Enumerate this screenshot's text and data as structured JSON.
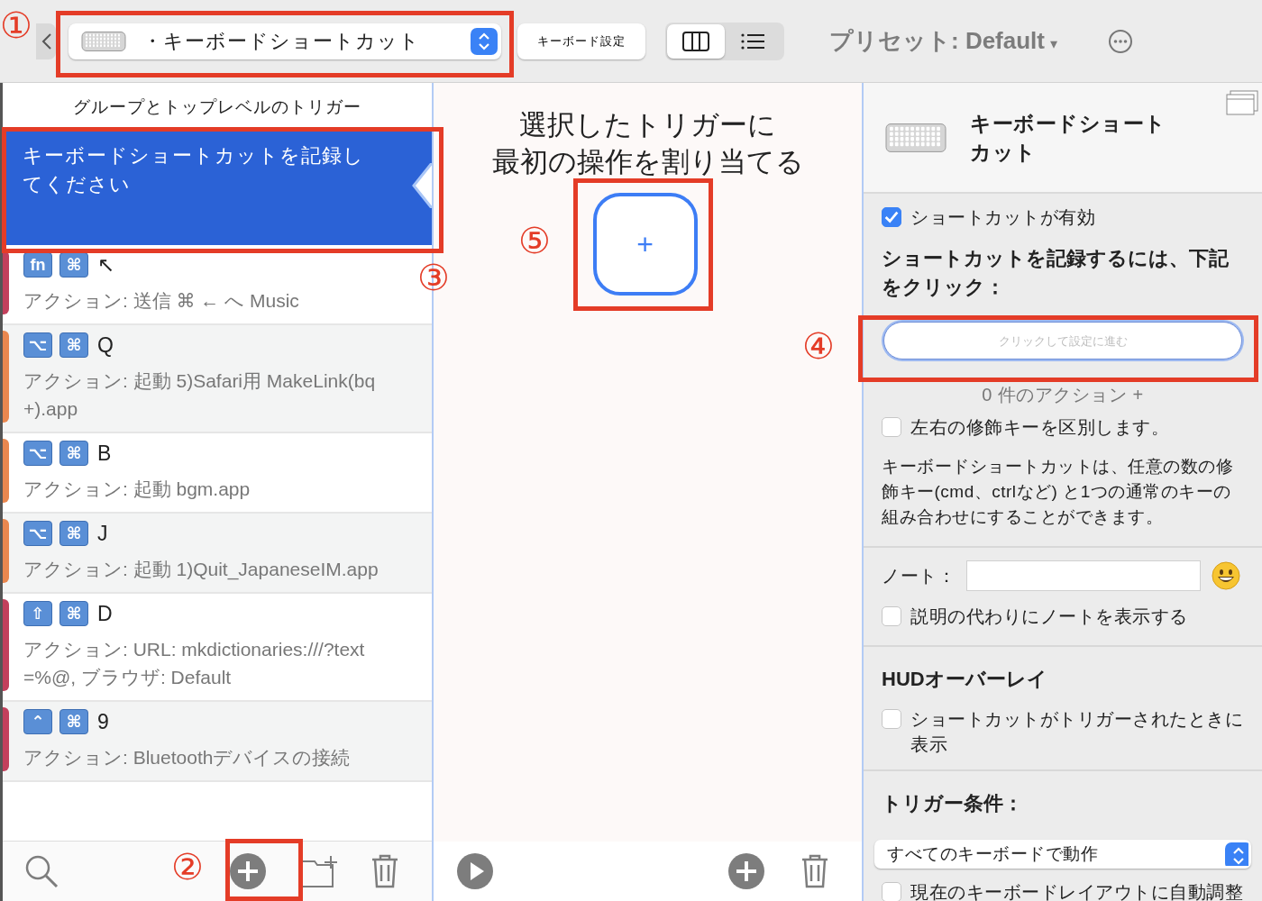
{
  "toolbar": {
    "trigger_type": "・キーボードショートカット",
    "settings_button": "キーボード設定",
    "view_modes": [
      {
        "kind": "columns",
        "selected": true
      },
      {
        "kind": "list",
        "selected": false
      }
    ],
    "preset": "プリセット: Default",
    "preset_caret": "▾"
  },
  "trigger_list": {
    "header": "グループとトップレベルのトリガー",
    "selected_item": "キーボードショートカットを記録してください",
    "items": [
      {
        "color": "#c2405c",
        "modifiers": [
          "fn",
          "⌘"
        ],
        "key": "↖",
        "action": "アクション: 送信 ⌘ ← へ Music"
      },
      {
        "color": "#e9874f",
        "modifiers": [
          "⌥",
          "⌘"
        ],
        "key": "Q",
        "action": "アクション: 起動 5)Safari用 MakeLink(bq+).app"
      },
      {
        "color": "#e9874f",
        "modifiers": [
          "⌥",
          "⌘"
        ],
        "key": "B",
        "action": "アクション: 起動 bgm.app"
      },
      {
        "color": "#e9874f",
        "modifiers": [
          "⌥",
          "⌘"
        ],
        "key": "J",
        "action": "アクション: 起動 1)Quit_JapaneseIM.app"
      },
      {
        "color": "#c2405c",
        "modifiers": [
          "⇧",
          "⌘"
        ],
        "key": "D",
        "action": "アクション: URL: mkdictionaries:///?text=%@, ブラウザ: Default"
      },
      {
        "color": "#c2405c",
        "modifiers": [
          "⌃",
          "⌘"
        ],
        "key": "9",
        "action": "アクション: Bluetoothデバイスの接続"
      }
    ]
  },
  "action_pane": {
    "title": [
      "選択したトリガーに",
      "最初の操作を割り当てる"
    ],
    "add_label": "+"
  },
  "inspector": {
    "title": "キーボードショートカット",
    "enabled": {
      "label": "ショートカットが有効",
      "checked": true
    },
    "record_heading": "ショートカットを記録するには、下記をクリック：",
    "record_field": {
      "placeholder": "クリックして設定に進む"
    },
    "action_count": "0 件のアクション +",
    "distinguish": {
      "label": "左右の修飾キーを区別します。",
      "checked": false
    },
    "description": "キーボードショートカットは、任意の数の修飾キー(cmd、ctrlなど) と1つの通常のキーの組み合わせにすることができます。",
    "note_label": "ノート：",
    "show_note": {
      "label": "説明の代わりにノートを表示する",
      "checked": false
    },
    "hud_heading": "HUDオーバーレイ",
    "hud": {
      "label": "ショートカットがトリガーされたときに表示",
      "checked": false
    },
    "condition_heading": "トリガー条件：",
    "keyboard_select": "すべてのキーボードで動作",
    "auto_adjust": {
      "label": "現在のキーボードレイアウトに自動調整",
      "checked": false
    }
  },
  "annotations": [
    {
      "label": "①"
    },
    {
      "label": "②"
    },
    {
      "label": "③"
    },
    {
      "label": "④"
    },
    {
      "label": "⑤"
    }
  ]
}
